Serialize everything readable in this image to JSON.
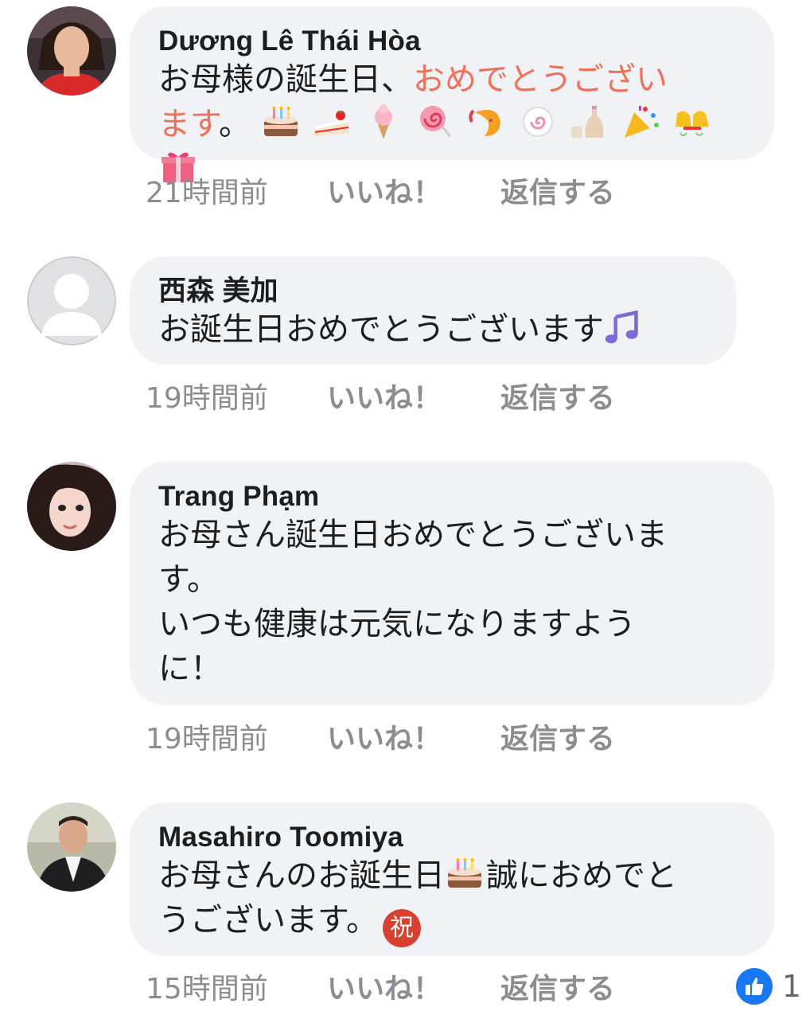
{
  "comments": [
    {
      "author": "Dương Lê Thái Hòa",
      "text_plain": "お母様の誕生日、",
      "text_highlight_1": "おめでとうござい",
      "text_highlight_2": "ます",
      "text_end": "。",
      "emojis": [
        "cake",
        "shortcake",
        "ice-cream",
        "lollipop",
        "shrimp",
        "fishcake",
        "sake",
        "party-popper",
        "bells",
        "gift"
      ],
      "time": "21時間前",
      "like": "いいね！",
      "reply": "返信する"
    },
    {
      "author": "西森 美加",
      "text": "お誕生日おめでとうございます",
      "emojis": [
        "music-note"
      ],
      "time": "19時間前",
      "like": "いいね！",
      "reply": "返信する"
    },
    {
      "author": "Trang Phạm",
      "lines": [
        "お母さん誕生日おめでとうございま",
        "す。",
        "いつも健康は元気になりますよう",
        "に！"
      ],
      "time": "19時間前",
      "like": "いいね！",
      "reply": "返信する"
    },
    {
      "author": "Masahiro Toomiya",
      "text_a": "お母さんのお誕生日",
      "text_b": "誠におめでと",
      "text_c": "うございます。",
      "badge": "祝",
      "emojis": [
        "cake"
      ],
      "time": "15時間前",
      "like": "いいね！",
      "reply": "返信する",
      "reaction_count": "1"
    }
  ],
  "colors": {
    "bubble": "#f0f2f5",
    "meta": "#8a8d91",
    "highlight": "#f0705a",
    "like_blue": "#1877f2"
  }
}
